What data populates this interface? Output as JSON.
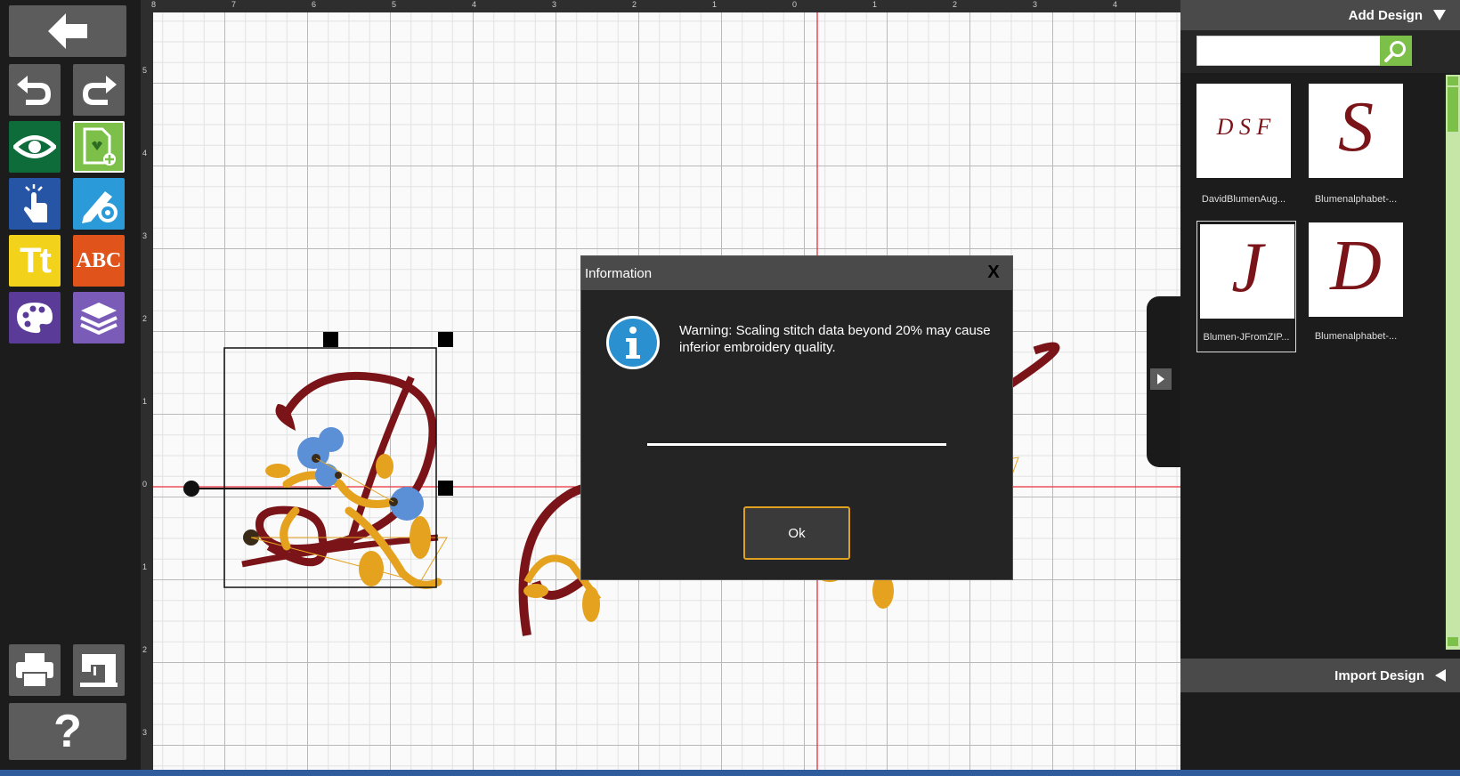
{
  "toolbar": {
    "buttons": [
      {
        "id": "back",
        "icon": "back-arrow-icon",
        "color": "#5c5c5c"
      },
      {
        "id": "undo",
        "icon": "undo-icon",
        "color": "#5c5c5c"
      },
      {
        "id": "redo",
        "icon": "redo-icon",
        "color": "#5c5c5c"
      },
      {
        "id": "view",
        "icon": "eye-icon",
        "color": "#0e6b3a"
      },
      {
        "id": "add-design",
        "icon": "add-design-icon",
        "color": "#7cc04a"
      },
      {
        "id": "select",
        "icon": "pointer-hand-icon",
        "color": "#2755a6"
      },
      {
        "id": "edit",
        "icon": "edit-gear-icon",
        "color": "#2a9ad9"
      },
      {
        "id": "text",
        "icon": "text-tt-icon",
        "color": "#f2d21b",
        "label": "Tt"
      },
      {
        "id": "monogram",
        "icon": "monogram-abc-icon",
        "color": "#e0541c",
        "label": "ABC"
      },
      {
        "id": "color",
        "icon": "palette-icon",
        "color": "#5a3c98"
      },
      {
        "id": "layers",
        "icon": "layers-icon",
        "color": "#7a5cb8"
      },
      {
        "id": "print",
        "icon": "printer-icon",
        "color": "#5c5c5c"
      },
      {
        "id": "send",
        "icon": "sewing-machine-icon",
        "color": "#5c5c5c"
      },
      {
        "id": "help",
        "icon": "help-question-icon",
        "color": "#5c5c5c",
        "label": "?"
      }
    ]
  },
  "rulers": {
    "top_labels": [
      "8",
      "7",
      "6",
      "5",
      "4",
      "3",
      "2",
      "1",
      "0",
      "1",
      "2",
      "3",
      "4"
    ],
    "left_labels": [
      "5",
      "4",
      "3",
      "2",
      "1",
      "0",
      "1",
      "2",
      "3"
    ]
  },
  "right_panel": {
    "add_design_label": "Add Design",
    "add_design_icon": "triangle-down-icon",
    "search_placeholder": "",
    "search_icon": "magnifier-icon",
    "designs": [
      {
        "label": "DavidBlumenAug...",
        "letter": "D S F",
        "selected": false
      },
      {
        "label": "Blumenalphabet-...",
        "letter": "S",
        "selected": false
      },
      {
        "label": "Blumen-JFromZIP...",
        "letter": "J",
        "selected": true
      },
      {
        "label": "Blumenalphabet-...",
        "letter": "D",
        "selected": false
      }
    ],
    "import_design_label": "Import Design",
    "import_design_icon": "triangle-left-icon"
  },
  "dialog": {
    "title": "Information",
    "close_label": "X",
    "message": "Warning: Scaling stitch data beyond 20% may cause inferior embroidery quality.",
    "ok_label": "Ok",
    "icon": "info-icon"
  },
  "colors": {
    "thread_maroon": "#7a1418",
    "thread_gold": "#e4a21f",
    "thread_blue": "#5b8fd6",
    "axis_red": "#e8303a",
    "accent_green": "#7cc04a",
    "ok_border": "#e0a020"
  }
}
